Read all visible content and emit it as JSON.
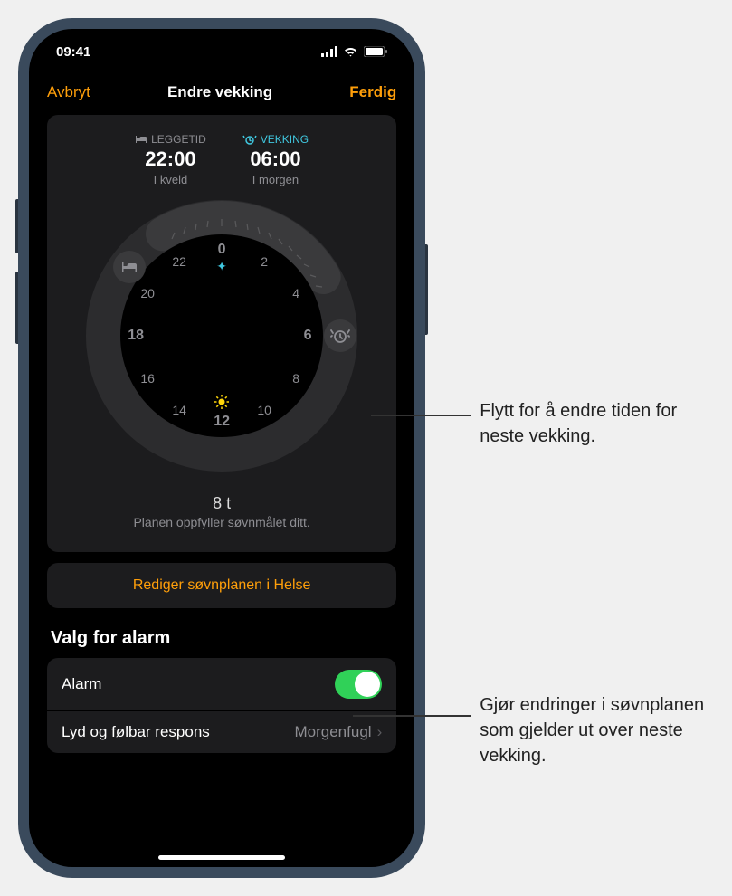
{
  "status": {
    "time": "09:41"
  },
  "nav": {
    "cancel": "Avbryt",
    "title": "Endre vekking",
    "done": "Ferdig"
  },
  "bedtime": {
    "label": "LEGGETID",
    "time": "22:00",
    "sub": "I kveld"
  },
  "wake": {
    "label": "VEKKING",
    "time": "06:00",
    "sub": "I morgen"
  },
  "clock": {
    "hours": [
      "0",
      "2",
      "4",
      "6",
      "8",
      "10",
      "12",
      "14",
      "16",
      "18",
      "20",
      "22"
    ]
  },
  "duration": {
    "value": "8 t",
    "text": "Planen oppfyller søvnmålet ditt."
  },
  "edit_button": "Rediger søvnplanen i Helse",
  "alarm_section": {
    "title": "Valg for alarm",
    "alarm_label": "Alarm",
    "sound_label": "Lyd og følbar respons",
    "sound_value": "Morgenfugl"
  },
  "callouts": {
    "handle": "Flytt for å endre tiden for neste vekking.",
    "edit": "Gjør endringer i søvnplanen som gjelder ut over neste vekking."
  }
}
